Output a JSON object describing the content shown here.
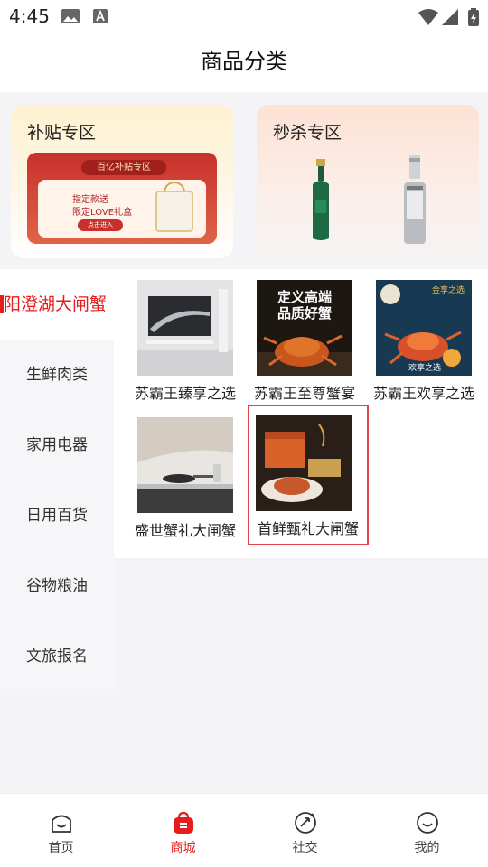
{
  "status_bar": {
    "time": "4:45"
  },
  "header": {
    "title": "商品分类"
  },
  "promos": [
    {
      "title": "补贴专区",
      "banner": {
        "tag": "百亿补贴专区",
        "line1": "指定款送",
        "line2": "限定LOVE礼盒",
        "cta": "点击进入"
      }
    },
    {
      "title": "秒杀专区"
    }
  ],
  "sidebar": {
    "items": [
      {
        "label": "阳澄湖大闸蟹"
      },
      {
        "label": "生鲜肉类"
      },
      {
        "label": "家用电器"
      },
      {
        "label": "日用百货"
      },
      {
        "label": "谷物粮油"
      },
      {
        "label": "文旅报名"
      }
    ]
  },
  "products": [
    {
      "name": "苏霸王臻享之选"
    },
    {
      "name": "苏霸王至尊蟹宴",
      "poster_l1": "定义高端",
      "poster_l2": "品质好蟹"
    },
    {
      "name": "苏霸王欢享之选",
      "poster_top": "金享之选",
      "poster_bottom": "欢享之选"
    },
    {
      "name": "盛世蟹礼大闸蟹"
    },
    {
      "name": "首鲜甄礼大闸蟹"
    }
  ],
  "tabbar": {
    "items": [
      {
        "label": "首页"
      },
      {
        "label": "商城"
      },
      {
        "label": "社交"
      },
      {
        "label": "我的"
      }
    ]
  },
  "colors": {
    "accent": "#e51d1d",
    "selected_outline": "#e0474c"
  },
  "icons": [
    "image-icon",
    "a-icon",
    "wifi-icon",
    "signal-icon",
    "battery-icon",
    "home-icon",
    "shop-bag-icon",
    "social-icon",
    "profile-icon"
  ]
}
